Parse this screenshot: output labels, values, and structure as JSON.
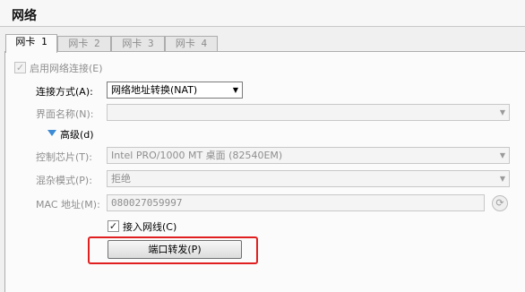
{
  "header": {
    "title": "网络"
  },
  "tabs": [
    {
      "label": "网卡 1"
    },
    {
      "label": "网卡 2"
    },
    {
      "label": "网卡 3"
    },
    {
      "label": "网卡 4"
    }
  ],
  "adapter": {
    "enable_label": "启用网络连接(E)",
    "attached_label": "连接方式(A):",
    "attached_value": "网络地址转换(NAT)",
    "name_label": "界面名称(N):",
    "name_value": "",
    "advanced_label": "高级(d)",
    "chip_label": "控制芯片(T):",
    "chip_value": "Intel PRO/1000 MT 桌面 (82540EM)",
    "promisc_label": "混杂模式(P):",
    "promisc_value": "拒绝",
    "mac_label": "MAC 地址(M):",
    "mac_value": "080027059997",
    "cable_label": "接入网线(C)",
    "port_forward_button": "端口转发(P)"
  },
  "icons": {
    "dropdown": "chevron-down-icon",
    "expand": "triangle-down-icon",
    "refresh": "refresh-icon",
    "check": "check-icon"
  },
  "colors": {
    "highlight_box": "#e02020",
    "expand_triangle": "#3c8bd6"
  }
}
